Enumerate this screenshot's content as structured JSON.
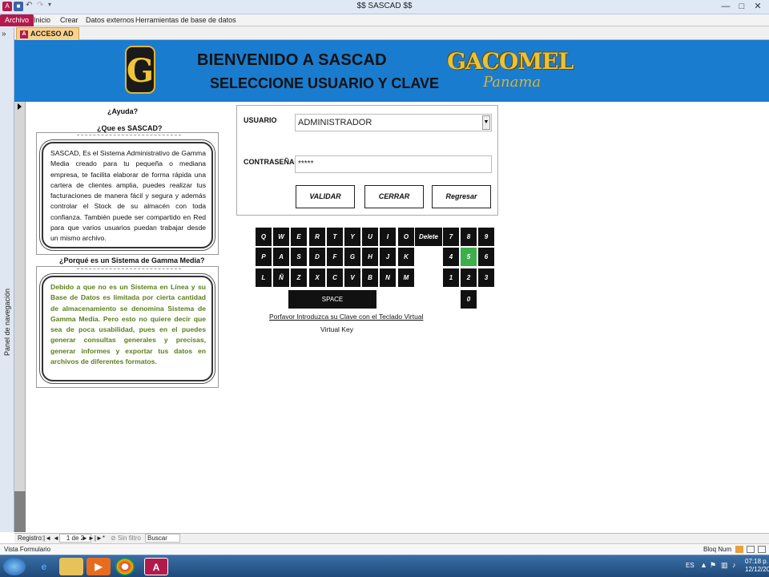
{
  "window": {
    "title": "$$ SASCAD $$",
    "controls": [
      "—",
      "□",
      "✕"
    ]
  },
  "ribbon": {
    "tabs": [
      "Archivo",
      "Inicio",
      "Crear",
      "Datos externos",
      "Herramientas de base de datos"
    ]
  },
  "nav_pane": {
    "label": "Panel de navegación",
    "toggle": "»"
  },
  "document_tab": {
    "label": "ACCESO AD",
    "icon": "A"
  },
  "header": {
    "logo_letter": "G",
    "welcome": "BIENVENIDO A SASCAD",
    "instruction": "SELECCIONE USUARIO Y CLAVE",
    "brand": "GACOMEL",
    "brand_sub": "Panama"
  },
  "help": {
    "title": "¿Ayuda?",
    "q1": "¿Que es SASCAD?",
    "a1": "SASCAD, Es el Sistema Administrativo de Gamma Media creado para tu pequeña o mediana empresa, te facilita elaborar de forma rápida una cartera de clientes amplia, puedes realizar tus facturaciones de manera fácil y segura y además controlar el Stock de su almacén con toda confianza. También puede ser compartido en Red para que varios usuarios puedan trabajar desde un mismo archivo.",
    "q2": "¿Porqué es un Sistema de Gamma Media?",
    "a2": "Debido a que no es un Sistema en Línea y su Base de Datos es limitada por cierta cantidad de almacenamiento se denomina Sistema de Gamma Media. Pero esto no quiere decir que sea de poca usabilidad, pues en el puedes generar consultas generales y precisas, generar informes y exportar tus datos en archivos de diferentes formatos."
  },
  "login": {
    "user_label": "USUARIO",
    "user_value": "ADMINISTRADOR",
    "password_label": "CONTRASEÑA",
    "password_value": "*****",
    "buttons": {
      "validate": "VALIDAR",
      "close": "CERRAR",
      "back": "Regresar"
    }
  },
  "keyboard": {
    "row1": [
      "Q",
      "W",
      "E",
      "R",
      "T",
      "Y",
      "U",
      "I",
      "O"
    ],
    "delete": "Delete",
    "row2": [
      "P",
      "A",
      "S",
      "D",
      "F",
      "G",
      "H",
      "J",
      "K"
    ],
    "row3": [
      "L",
      "Ñ",
      "Z",
      "X",
      "C",
      "V",
      "B",
      "N",
      "M"
    ],
    "space": "SPACE",
    "numpad": [
      [
        "7",
        "8",
        "9"
      ],
      [
        "4",
        "5",
        "6"
      ],
      [
        "1",
        "2",
        "3"
      ],
      [
        "0"
      ]
    ],
    "highlighted": "5",
    "highlight_color": "#3cae4a",
    "message": "Porfavor Introduzca su Clave con el Teclado Virtual",
    "label": "Virtual Key"
  },
  "record_nav": {
    "label": "Registro:",
    "first": "|◄",
    "prev": "◄",
    "position": "1 de 2",
    "next": "►",
    "last": "►|",
    "new": "►*",
    "filter": "Sin filtro",
    "search": "Buscar"
  },
  "status_bar": {
    "left": "Vista Formulario",
    "right": "Bloq Num"
  },
  "taskbar": {
    "language": "ES",
    "time": "07:18 p.",
    "date": "12/12/20"
  },
  "colors": {
    "header_bg": "#1a7ccf",
    "accent": "#b21a4d",
    "green_text": "#5d7e1c"
  }
}
